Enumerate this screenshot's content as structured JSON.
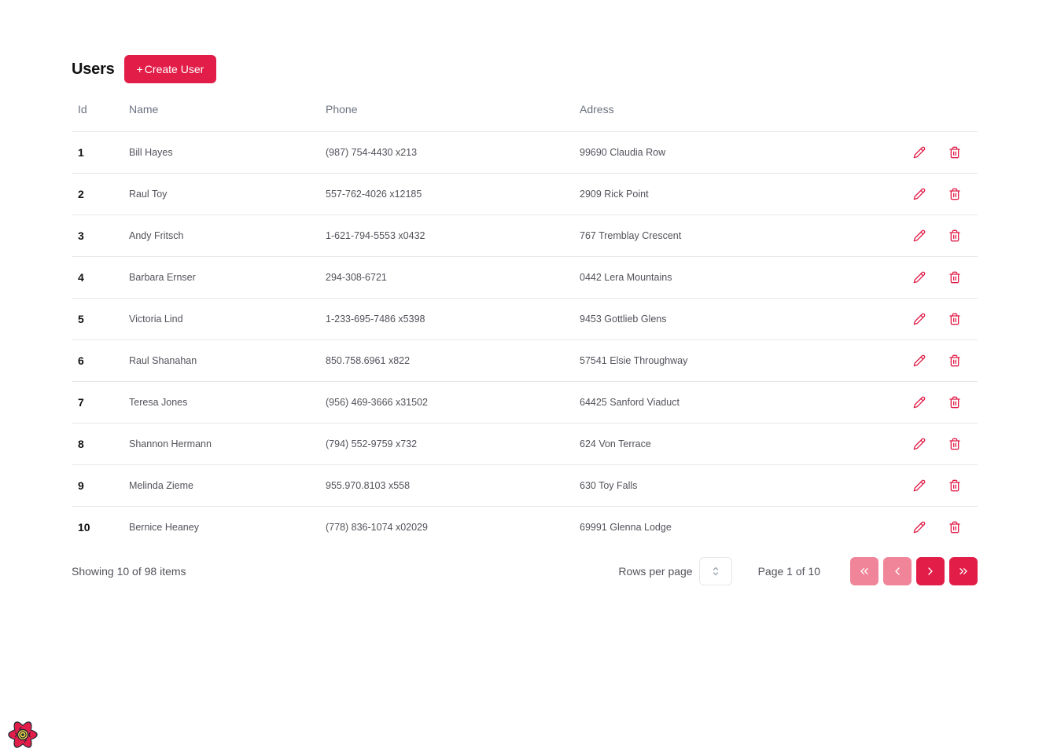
{
  "header": {
    "title": "Users",
    "create_button_plus": "+",
    "create_button_label": "Create User"
  },
  "table": {
    "columns": {
      "id": "Id",
      "name": "Name",
      "phone": "Phone",
      "address": "Adress"
    },
    "rows": [
      {
        "id": "1",
        "name": "Bill Hayes",
        "phone": "(987) 754-4430 x213",
        "address": "99690 Claudia Row"
      },
      {
        "id": "2",
        "name": "Raul Toy",
        "phone": "557-762-4026 x12185",
        "address": "2909 Rick Point"
      },
      {
        "id": "3",
        "name": "Andy Fritsch",
        "phone": "1-621-794-5553 x0432",
        "address": "767 Tremblay Crescent"
      },
      {
        "id": "4",
        "name": "Barbara Ernser",
        "phone": "294-308-6721",
        "address": "0442 Lera Mountains"
      },
      {
        "id": "5",
        "name": "Victoria Lind",
        "phone": "1-233-695-7486 x5398",
        "address": "9453 Gottlieb Glens"
      },
      {
        "id": "6",
        "name": "Raul Shanahan",
        "phone": "850.758.6961 x822",
        "address": "57541 Elsie Throughway"
      },
      {
        "id": "7",
        "name": "Teresa Jones",
        "phone": "(956) 469-3666 x31502",
        "address": "64425 Sanford Viaduct"
      },
      {
        "id": "8",
        "name": "Shannon Hermann",
        "phone": "(794) 552-9759 x732",
        "address": "624 Von Terrace"
      },
      {
        "id": "9",
        "name": "Melinda Zieme",
        "phone": "955.970.8103 x558",
        "address": "630 Toy Falls"
      },
      {
        "id": "10",
        "name": "Bernice Heaney",
        "phone": "(778) 836-1074 x02029",
        "address": "69991 Glenna Lodge"
      }
    ],
    "row_actions": {
      "edit_icon": "pencil-icon",
      "delete_icon": "trash-icon"
    }
  },
  "footer": {
    "showing": "Showing 10 of 98 items",
    "rows_per_page_label": "Rows per page",
    "rows_per_page_value": "",
    "page_info": "Page 1 of 10",
    "buttons": {
      "first": {
        "icon": "chevrons-left-icon",
        "disabled": true
      },
      "prev": {
        "icon": "chevron-left-icon",
        "disabled": true
      },
      "next": {
        "icon": "chevron-right-icon",
        "disabled": false
      },
      "last": {
        "icon": "chevrons-right-icon",
        "disabled": false
      }
    }
  },
  "colors": {
    "accent": "#e11d48",
    "accent_disabled": "#f08599",
    "border": "#e5e7eb",
    "muted_text": "#52525b"
  },
  "devtools": {
    "icon": "react-logo-icon"
  }
}
